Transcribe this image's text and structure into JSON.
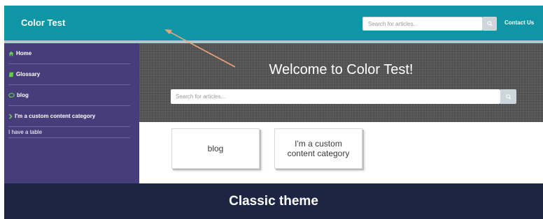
{
  "header": {
    "brand": "Color Test",
    "search_placeholder": "Search for articles...",
    "search_icon": "search-icon",
    "contact_label": "Contact Us"
  },
  "sidebar": {
    "items": [
      {
        "label": "Home",
        "icon": "home-icon"
      },
      {
        "label": "Glossary",
        "icon": "book-icon"
      },
      {
        "label": "blog",
        "icon": "speech-bubble-icon"
      },
      {
        "label": "I'm a custom content category",
        "icon": "chevron-right-icon"
      }
    ],
    "sub_items": [
      {
        "label": "I have a table"
      }
    ]
  },
  "hero": {
    "title": "Welcome to Color Test!",
    "search_placeholder": "Search for articles...",
    "search_icon": "search-icon"
  },
  "cards": [
    {
      "label": "blog"
    },
    {
      "label": "I'm a custom content category"
    }
  ],
  "footer": {
    "label": "Classic theme"
  },
  "colors": {
    "header": "#0f96a6",
    "sidebar": "#463d7a",
    "nav_icon": "#5fd148",
    "footer": "#1c2644",
    "annotation_arrow": "#f0a47a"
  }
}
